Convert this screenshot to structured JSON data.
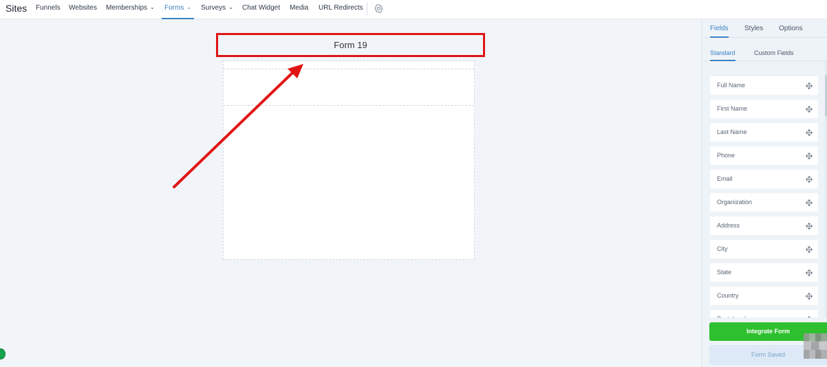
{
  "topnav": {
    "brand": "Sites",
    "items": [
      {
        "label": "Funnels"
      },
      {
        "label": "Websites"
      },
      {
        "label": "Memberships"
      },
      {
        "label": "Forms"
      },
      {
        "label": "Surveys"
      },
      {
        "label": "Chat Widget"
      },
      {
        "label": "Media"
      },
      {
        "label": "URL Redirects"
      }
    ],
    "active_item": "Forms",
    "settings_icon": "gear-icon"
  },
  "canvas": {
    "form_title": "Form 19"
  },
  "panel": {
    "tabs": [
      {
        "label": "Fields"
      },
      {
        "label": "Styles"
      },
      {
        "label": "Options"
      }
    ],
    "active_tab": "Fields",
    "sub_tabs": [
      {
        "label": "Standard"
      },
      {
        "label": "Custom Fields"
      }
    ],
    "active_sub_tab": "Standard",
    "fields": [
      {
        "label": "Full Name"
      },
      {
        "label": "First Name"
      },
      {
        "label": "Last Name"
      },
      {
        "label": "Phone"
      },
      {
        "label": "Email"
      },
      {
        "label": "Organization"
      },
      {
        "label": "Address"
      },
      {
        "label": "City"
      },
      {
        "label": "State"
      },
      {
        "label": "Country"
      },
      {
        "label": "Postal code"
      }
    ],
    "integrate_label": "Integrate Form",
    "saved_label": "Form Saved"
  },
  "colors": {
    "accent": "#3b82c4",
    "highlight": "#e11414",
    "integrate": "#2ec02e"
  }
}
